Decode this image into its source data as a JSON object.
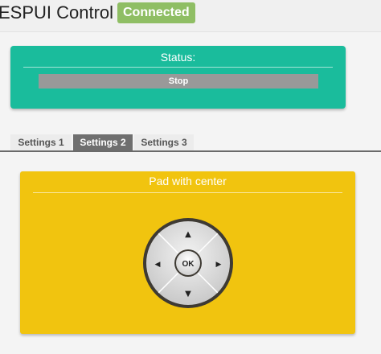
{
  "header": {
    "title": "ESPUI Control",
    "connection_status": "Connected"
  },
  "status_panel": {
    "label": "Status:",
    "button_label": "Stop"
  },
  "tabs": [
    {
      "label": "Settings 1",
      "active": false
    },
    {
      "label": "Settings 2",
      "active": true
    },
    {
      "label": "Settings 3",
      "active": false
    }
  ],
  "pad_panel": {
    "label": "Pad with center",
    "center_label": "OK",
    "arrows": {
      "up": "▲",
      "down": "▼",
      "left": "◀",
      "right": "▶"
    }
  },
  "colors": {
    "status_card": "#1abc9c",
    "pad_card": "#f1c40f",
    "badge_connected": "#8fbe64",
    "active_tab": "#6f6f6f"
  }
}
